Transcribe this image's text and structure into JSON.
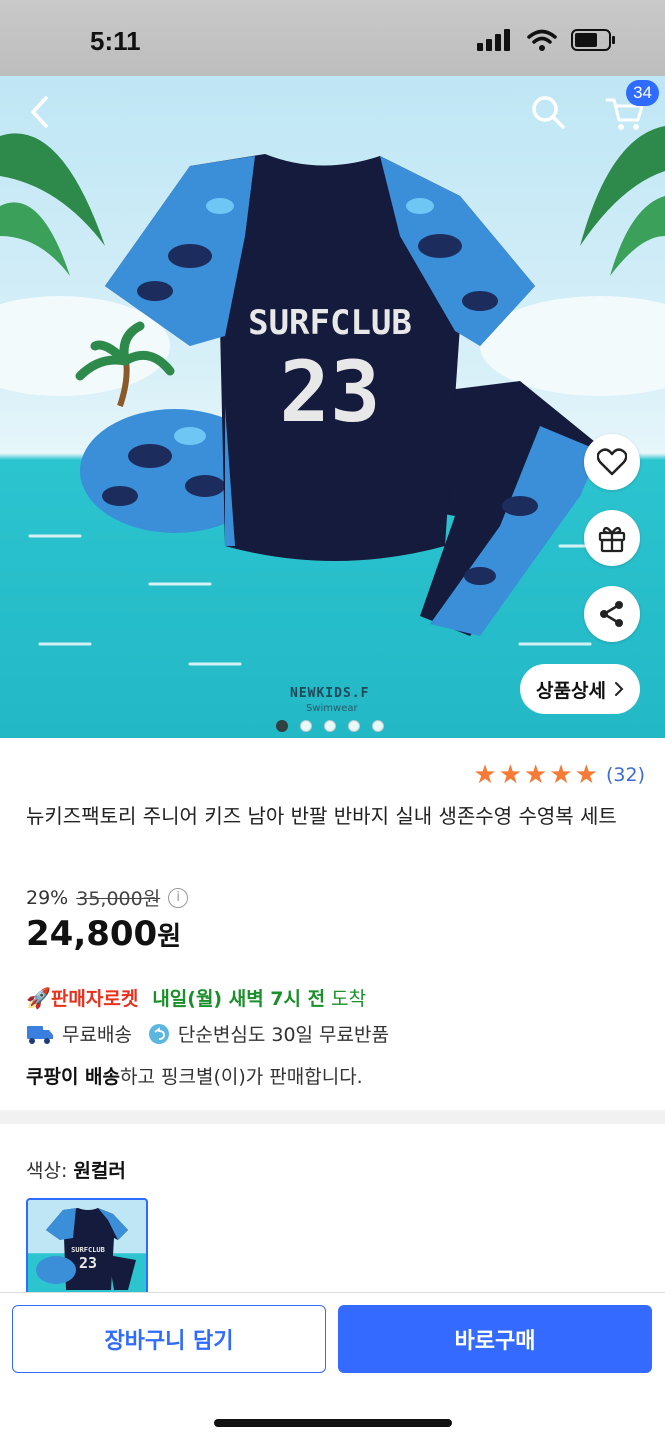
{
  "status_bar": {
    "time": "5:11"
  },
  "header": {
    "cart_count": "34"
  },
  "hero": {
    "brand": "NEWKIDS.F",
    "brand_sub": "Swimwear",
    "shirt_text": "SURFCLUB",
    "shirt_number": "23",
    "detail_button": "상품상세",
    "page_dots": 5,
    "active_dot": 1
  },
  "product": {
    "rating_stars": 5,
    "rating_count": "(32)",
    "title": "뉴키즈팩토리 주니어 키즈 남아 반팔 반바지 실내 생존수영 수영복 세트",
    "discount": "29%",
    "original_price": "35,000원",
    "price": "24,800",
    "price_unit": "원"
  },
  "delivery": {
    "rocket_label": "판매자로켓",
    "eta": "내일(월) 새벽 7시 전",
    "eta_suffix": "도착",
    "free_shipping": "무료배송",
    "return_policy": "단순변심도 30일 무료반품",
    "seller_bold": "쿠팡이 배송",
    "seller_rest": "하고 핑크별(이)가 판매합니다."
  },
  "options": {
    "color_label": "색상:",
    "color_value": "원컬러"
  },
  "bottom_bar": {
    "add_to_cart": "장바구니 담기",
    "buy_now": "바로구매"
  },
  "colors": {
    "accent": "#346aff",
    "star": "#f57a36",
    "rocket": "#e8321e",
    "eta": "#1a8f2a"
  }
}
